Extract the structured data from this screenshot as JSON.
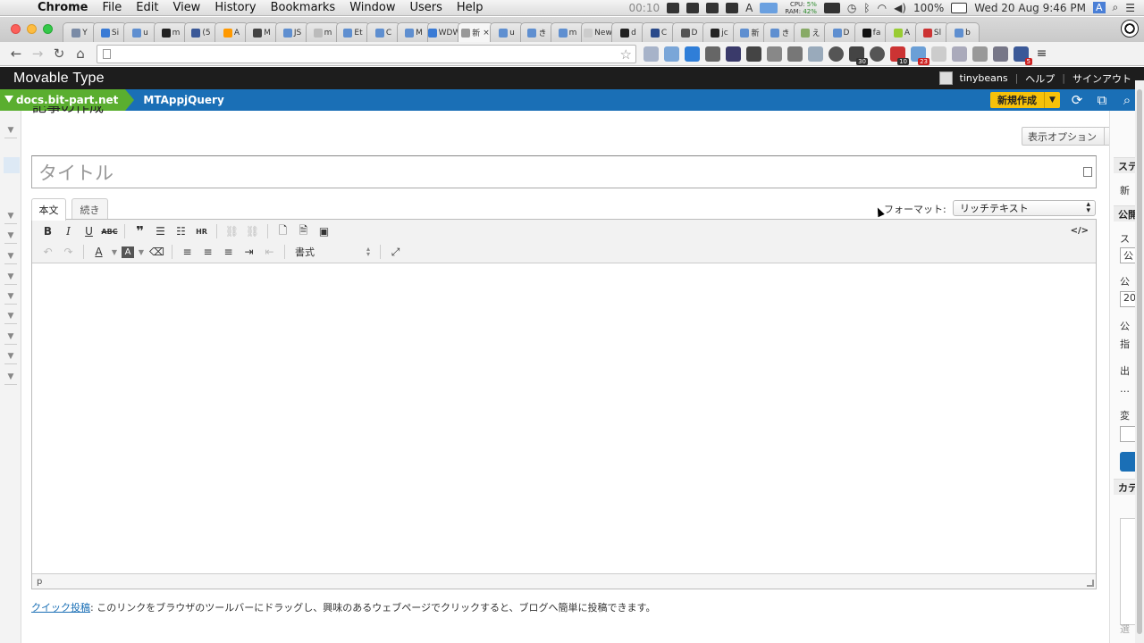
{
  "menubar": {
    "apple": "",
    "items": [
      "Chrome",
      "File",
      "Edit",
      "View",
      "History",
      "Bookmarks",
      "Window",
      "Users",
      "Help"
    ],
    "timer": "00:10",
    "cpu_label": "CPU:",
    "cpu_value": "5%",
    "ram_label": "RAM:",
    "ram_value": "42%",
    "battery": "100%",
    "clock": "Wed 20 Aug  9:46 PM",
    "input_badge": "A"
  },
  "tabs": [
    "Y",
    "Si",
    "u",
    "m",
    "(5",
    "A",
    "M",
    "JS",
    "m",
    "Et",
    "C",
    "M",
    "WDW",
    "新",
    "u",
    "き",
    "m",
    "New",
    "d",
    "C",
    "D",
    "jc",
    "新",
    "き",
    "え",
    "D",
    "fa",
    "A",
    "Sl",
    "b"
  ],
  "active_tab_index": 13,
  "toolbar": {
    "back": "←",
    "forward": "→",
    "reload": "↻",
    "home": "⌂",
    "url": "",
    "star": "☆",
    "ext_badges": [
      "30",
      "10",
      "23",
      "5"
    ]
  },
  "mt": {
    "logo": "Movable Type",
    "user": "tinybeans",
    "help": "ヘルプ",
    "signout": "サインアウト",
    "site": "docs.bit-part.net",
    "blog": "MTAppjQuery",
    "new_button": "新規作成"
  },
  "page": {
    "title": "記事の作成",
    "display_options": "表示オプション",
    "title_placeholder": "タイトル",
    "tab_body": "本文",
    "tab_more": "続き",
    "format_label": "フォーマット:",
    "format_value": "リッチテキスト",
    "style_select": "書式",
    "code_toggle": "</>",
    "status_path": "p",
    "quickpost_link": "クイック投稿",
    "quickpost_text": ": このリンクをブラウザのツールバーにドラッグし、興味のあるウェブページでクリックすると、ブログへ簡単に投稿できます。"
  },
  "right_sidebar": {
    "head1": "ステ",
    "text1": "新",
    "head2": "公開",
    "text2": "ス",
    "box1": "公",
    "text3": "公",
    "box2": "20",
    "text4": "公",
    "text5": "指",
    "text6": "出",
    "text7": "…",
    "text8": "変",
    "head3": "カテ",
    "text9": "選"
  },
  "colors": {
    "mt_header": "#1d1d1d",
    "blog_bar": "#1a6fb6",
    "site_crumb": "#5aae2f",
    "new_button": "#f6c10a"
  }
}
